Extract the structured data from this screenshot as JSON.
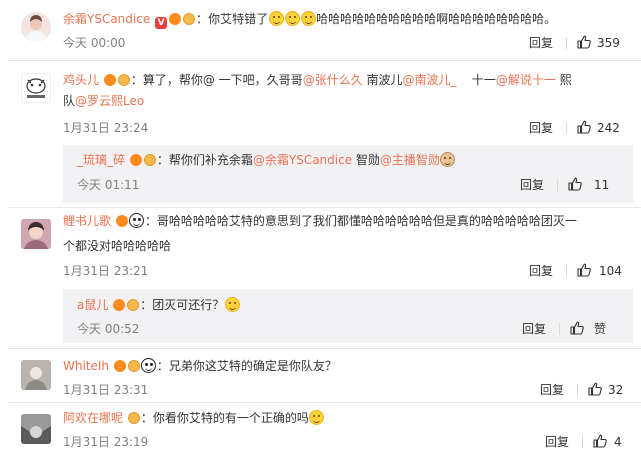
{
  "comments": [
    {
      "user": "余霜YSCandice",
      "text": "你艾特错了",
      "text2": "哈哈哈哈哈哈哈哈哈哈啊哈哈哈哈哈哈哈哈。",
      "time": "今天 00:00",
      "reply": "回复",
      "likes": "359"
    },
    {
      "user": "鸡头儿",
      "text_pre": "算了，帮你@ 一下吧，久哥哥",
      "m1": "@张什么久",
      "mid": " 南波儿",
      "m2": "@南波儿_",
      "gap": "    十一",
      "m3": "@解说十一",
      "end": " 熙",
      "line2_pre": "队",
      "m4": "@罗云熙Leo",
      "time": "1月31日 23:24",
      "reply": "回复",
      "likes": "242"
    },
    {
      "user": "_琉璃_碎",
      "text_pre": "帮你们补充余霜",
      "m1": "@余霜YSCandice",
      "mid": " 智勋",
      "m2": "@主播智勋",
      "time": "今天 01:11",
      "reply": "回复",
      "likes": "11"
    },
    {
      "user": "鲤书儿歌",
      "text": "哥哈哈哈哈哈艾特的意思到了我们都懂哈哈哈哈哈哈但是真的哈哈哈哈哈团灭一",
      "text2": "个都没对哈哈哈哈哈",
      "time": "1月31日 23:21",
      "reply": "回复",
      "likes": "104"
    },
    {
      "user": "a鼠儿",
      "text": "团灭可还行？",
      "time": "今天 00:52",
      "reply": "回复",
      "likes": "赞"
    },
    {
      "user": "WhiteIh",
      "text": "兄弟你这艾特的确定是你队友？",
      "time": "1月31日 23:31",
      "reply": "回复",
      "likes": "32"
    },
    {
      "user": "阿欢在哪呢",
      "text": "你看你艾特的有一个正确的吗",
      "time": "1月31日 23:19",
      "reply": "回复",
      "likes": "4"
    }
  ],
  "colors": {
    "username": "#eb7350",
    "time": "#808080",
    "reply_bg": "#f2f2f5"
  },
  "icons": {
    "like": "thumbs-up-icon"
  }
}
